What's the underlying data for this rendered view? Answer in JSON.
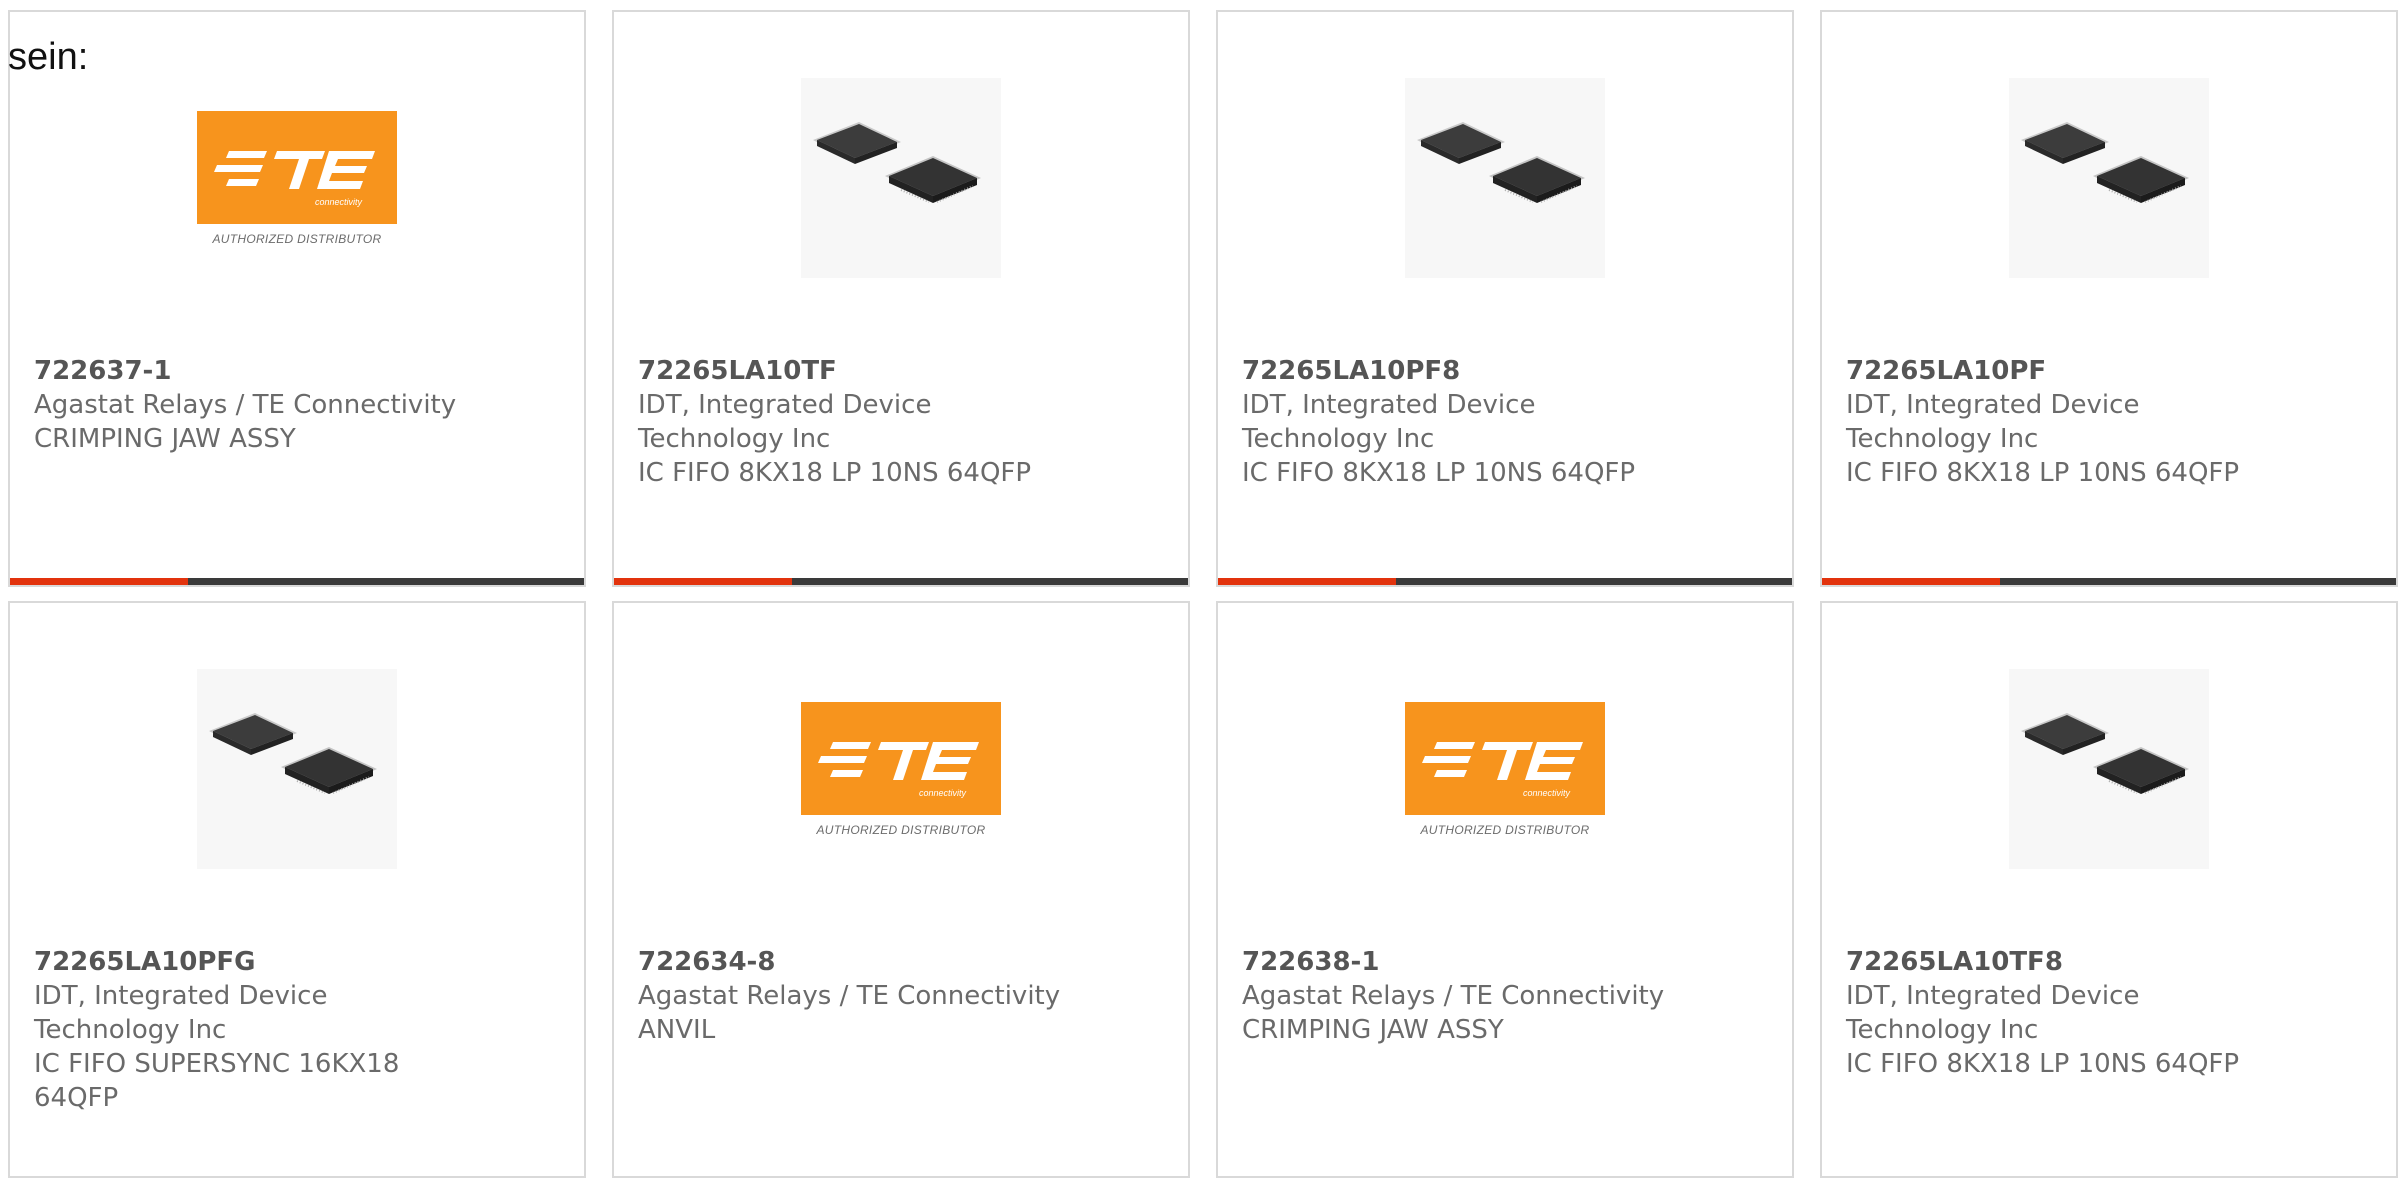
{
  "intro_text": "sein:",
  "colors": {
    "accent": "#e2330d",
    "bar": "#3a3a3a",
    "te_orange": "#f7941d"
  },
  "products": [
    {
      "part_number": "722637-1",
      "manufacturer": "Agastat Relays / TE Connectivity",
      "description": "CRIMPING JAW ASSY",
      "image": "te-logo",
      "image_caption": "AUTHORIZED DISTRIBUTOR",
      "progress": 0.31
    },
    {
      "part_number": "72265LA10TF",
      "manufacturer": "IDT, Integrated Device Technology Inc",
      "description": "IC FIFO 8KX18 LP 10NS 64QFP",
      "image": "chip",
      "progress": 0.31
    },
    {
      "part_number": "72265LA10PF8",
      "manufacturer": "IDT, Integrated Device Technology Inc",
      "description": "IC FIFO 8KX18 LP 10NS 64QFP",
      "image": "chip",
      "progress": 0.31
    },
    {
      "part_number": "72265LA10PF",
      "manufacturer": "IDT, Integrated Device Technology Inc",
      "description": "IC FIFO 8KX18 LP 10NS 64QFP",
      "image": "chip",
      "progress": 0.31
    },
    {
      "part_number": "72265LA10PFG",
      "manufacturer": "IDT, Integrated Device Technology Inc",
      "description": "IC FIFO SUPERSYNC 16KX18 64QFP",
      "image": "chip"
    },
    {
      "part_number": "722634-8",
      "manufacturer": "Agastat Relays / TE Connectivity",
      "description": "ANVIL",
      "image": "te-logo",
      "image_caption": "AUTHORIZED DISTRIBUTOR"
    },
    {
      "part_number": "722638-1",
      "manufacturer": "Agastat Relays / TE Connectivity",
      "description": "CRIMPING JAW ASSY",
      "image": "te-logo",
      "image_caption": "AUTHORIZED DISTRIBUTOR"
    },
    {
      "part_number": "72265LA10TF8",
      "manufacturer": "IDT, Integrated Device Technology Inc",
      "description": "IC FIFO 8KX18 LP 10NS 64QFP",
      "image": "chip"
    }
  ]
}
